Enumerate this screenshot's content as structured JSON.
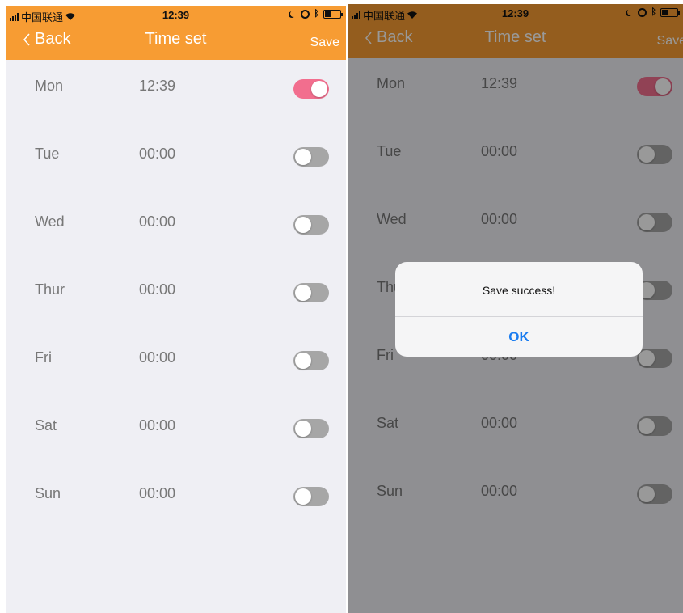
{
  "status_bar": {
    "carrier": "中国联通",
    "time": "12:39"
  },
  "nav": {
    "back_label": "Back",
    "title": "Time set",
    "save_label": "Save"
  },
  "schedule": [
    {
      "day": "Mon",
      "time": "12:39",
      "enabled": true
    },
    {
      "day": "Tue",
      "time": "00:00",
      "enabled": false
    },
    {
      "day": "Wed",
      "time": "00:00",
      "enabled": false
    },
    {
      "day": "Thur",
      "time": "00:00",
      "enabled": false
    },
    {
      "day": "Fri",
      "time": "00:00",
      "enabled": false
    },
    {
      "day": "Sat",
      "time": "00:00",
      "enabled": false
    },
    {
      "day": "Sun",
      "time": "00:00",
      "enabled": false
    }
  ],
  "alert": {
    "message": "Save success!",
    "ok_label": "OK"
  },
  "colors": {
    "header": "#f79c33",
    "toggle_on": "#f26e8e",
    "toggle_off": "#a6a6a6",
    "background": "#efeff4",
    "alert_button": "#1a7cf0"
  },
  "icons": [
    "signal-bars-icon",
    "wifi-icon",
    "moon-icon",
    "alarm-icon",
    "bluetooth-icon",
    "battery-icon",
    "chevron-left-icon"
  ]
}
